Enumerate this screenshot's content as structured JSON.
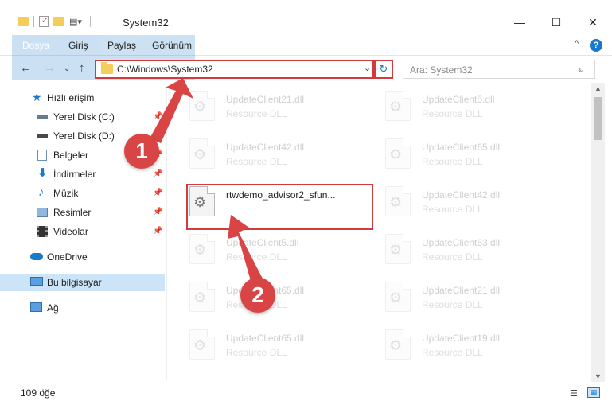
{
  "window": {
    "title": "System32",
    "min": "—",
    "max": "☐",
    "close": "✕"
  },
  "ribbon": {
    "file_tab": "Dosya",
    "tabs": [
      "Giriş",
      "Paylaş",
      "Görünüm"
    ],
    "help": "?",
    "collapse": "^"
  },
  "nav": {
    "back": "←",
    "forward": "→",
    "recent": "⌄",
    "up": "↑"
  },
  "address": {
    "path": "C:\\Windows\\System32",
    "chevron": "⌄",
    "refresh": "↻"
  },
  "search": {
    "placeholder": "Ara: System32",
    "icon": "⌕"
  },
  "sidebar": {
    "items": [
      {
        "label": "Hızlı erişim",
        "icon": "star-icon"
      },
      {
        "label": "Yerel Disk (C:)",
        "icon": "drive-icon"
      },
      {
        "label": "Yerel Disk (D:)",
        "icon": "drive-icon"
      },
      {
        "label": "Belgeler",
        "icon": "documents-icon"
      },
      {
        "label": "İndirmeler",
        "icon": "download-icon"
      },
      {
        "label": "Müzik",
        "icon": "music-icon"
      },
      {
        "label": "Resimler",
        "icon": "pictures-icon"
      },
      {
        "label": "Videolar",
        "icon": "video-icon"
      },
      {
        "label": "OneDrive",
        "icon": "cloud-icon"
      },
      {
        "label": "Bu bilgisayar",
        "icon": "computer-icon"
      },
      {
        "label": "Ağ",
        "icon": "network-icon"
      }
    ],
    "pin": "📌"
  },
  "files": [
    {
      "name": "UpdateClient21.dll",
      "type": "Resource DLL"
    },
    {
      "name": "UpdateClient5.dll",
      "type": "Resource DLL"
    },
    {
      "name": "UpdateClient42.dll",
      "type": "Resource DLL"
    },
    {
      "name": "UpdateClient65.dll",
      "type": "Resource DLL"
    },
    {
      "name": "rtwdemo_advisor2_sfun...",
      "type": ""
    },
    {
      "name": "UpdateClient42.dll",
      "type": "Resource DLL"
    },
    {
      "name": "UpdateClient5.dll",
      "type": "Resource DLL"
    },
    {
      "name": "UpdateClient63.dll",
      "type": "Resource DLL"
    },
    {
      "name": "UpdateClient65.dll",
      "type": "Resource DLL"
    },
    {
      "name": "UpdateClient21.dll",
      "type": "Resource DLL"
    },
    {
      "name": "UpdateClient65.dll",
      "type": "Resource DLL"
    },
    {
      "name": "UpdateClient19.dll",
      "type": "Resource DLL"
    }
  ],
  "status": {
    "count": "109 öğe"
  },
  "annotations": {
    "step1": "1",
    "step2": "2",
    "color": "#d94545"
  },
  "scrollbar": {
    "up": "▲",
    "down": "▼"
  }
}
